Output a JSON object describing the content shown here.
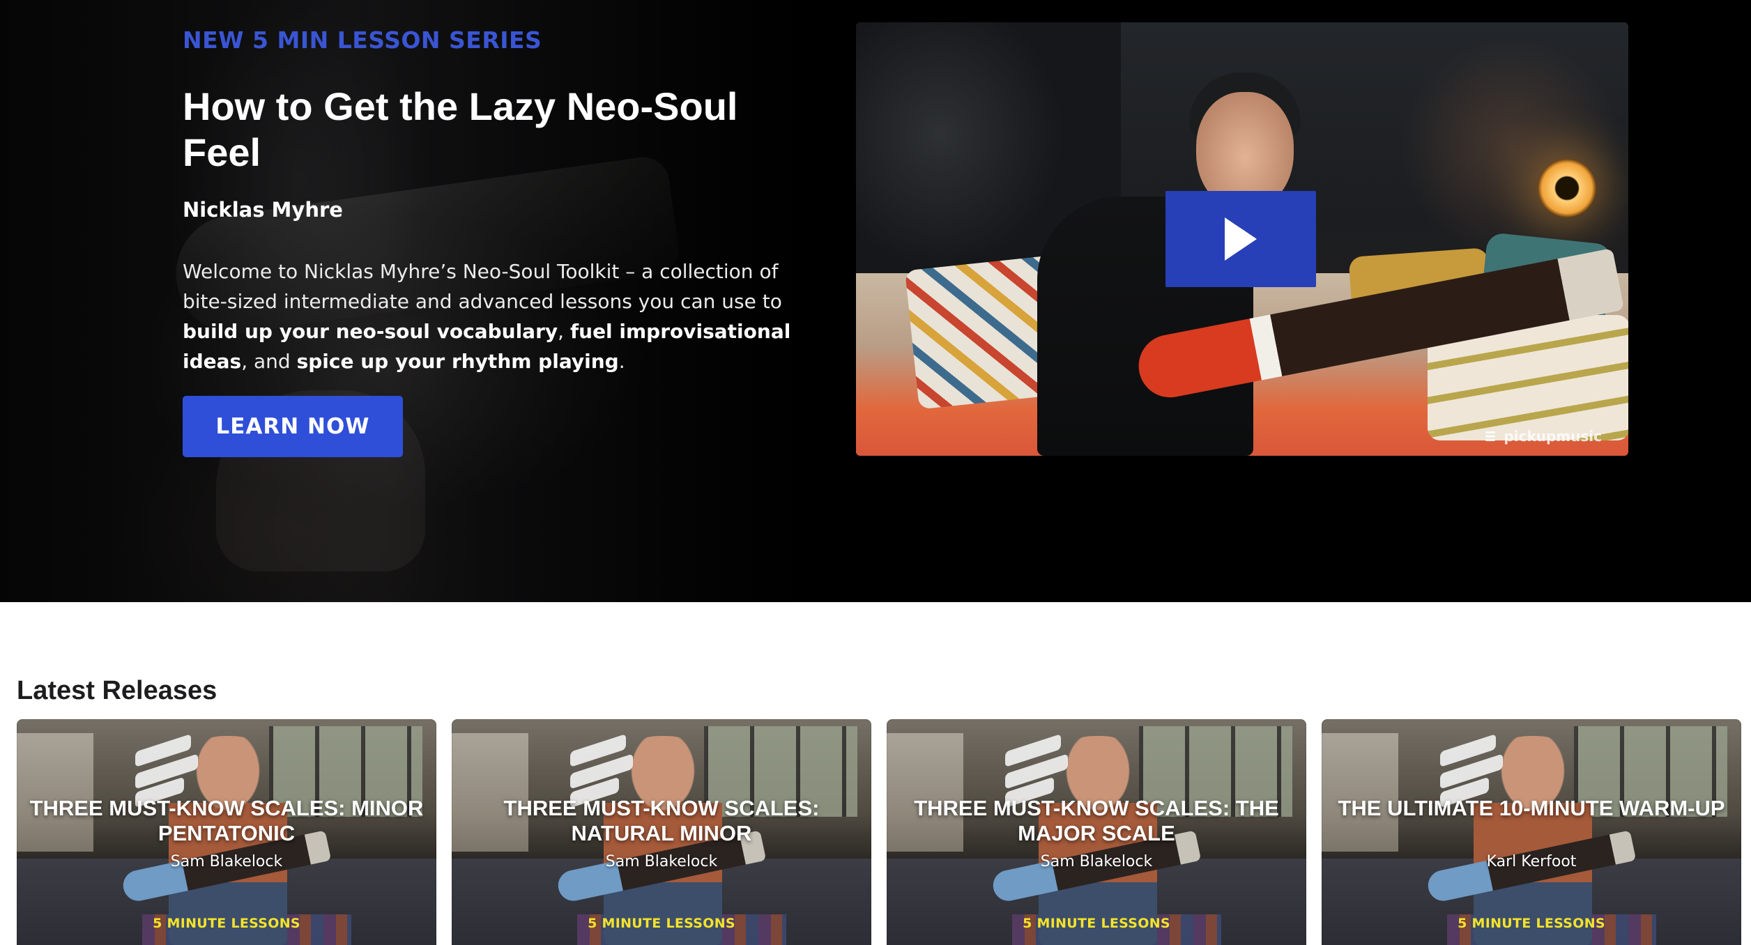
{
  "hero": {
    "eyebrow": "NEW 5 MIN LESSON SERIES",
    "title": "How to Get the Lazy Neo-Soul Feel",
    "author": "Nicklas Myhre",
    "description": {
      "intro": "Welcome to Nicklas Myhre’s Neo-Soul Toolkit – a collection of bite-sized intermediate and advanced lessons you can use to ",
      "bold1": "build up your neo-soul vocabulary",
      "sep1": ", ",
      "bold2": "fuel improvisational ideas",
      "sep2": ", and ",
      "bold3": "spice up your rhythm playing",
      "end": "."
    },
    "cta_label": "LEARN NOW",
    "video": {
      "play_icon": "play-icon",
      "watermark": "pickupmusic"
    }
  },
  "latest": {
    "heading": "Latest Releases",
    "cards": [
      {
        "title": "THREE MUST-KNOW SCALES: MINOR PENTATONIC",
        "instructor": "Sam Blakelock",
        "tag": "5 MINUTE LESSONS"
      },
      {
        "title": "THREE MUST-KNOW SCALES: NATURAL MINOR",
        "instructor": "Sam Blakelock",
        "tag": "5 MINUTE LESSONS"
      },
      {
        "title": "THREE MUST-KNOW SCALES: THE MAJOR SCALE",
        "instructor": "Sam Blakelock",
        "tag": "5 MINUTE LESSONS"
      },
      {
        "title": "THE ULTIMATE 10-MINUTE WARM-UP",
        "instructor": "Karl Kerfoot",
        "tag": "5 MINUTE LESSONS"
      }
    ]
  },
  "colors": {
    "accent": "#2f4fd9",
    "eyebrow": "#3a55d4",
    "play_button": "#2740b7",
    "card_tag": "#f5e32a"
  }
}
